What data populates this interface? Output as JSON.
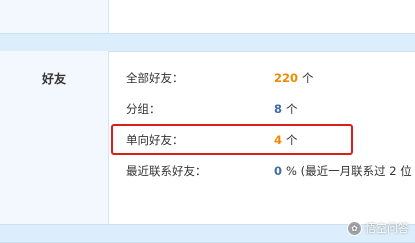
{
  "section": {
    "title": "好友"
  },
  "rows": [
    {
      "label": "全部好友：",
      "value": "220",
      "value_color": "#f08a00",
      "unit": "个"
    },
    {
      "label": "分组：",
      "value": "8",
      "value_color": "#3d6ea5",
      "unit": "个"
    },
    {
      "label": "单向好友：",
      "value": "4",
      "value_color": "#f08a00",
      "unit": "个"
    },
    {
      "label": "最近联系好友：",
      "value": "0",
      "value_color": "#3d6ea5",
      "unit": "% (最近一月联系过 2 位"
    }
  ],
  "watermark": {
    "text": "悟空问答",
    "logo_icon": "wukong-logo-icon"
  },
  "colors": {
    "band": "#dcedfb",
    "label_column": "#f2f8fe",
    "highlight_border": "#d8201a"
  }
}
